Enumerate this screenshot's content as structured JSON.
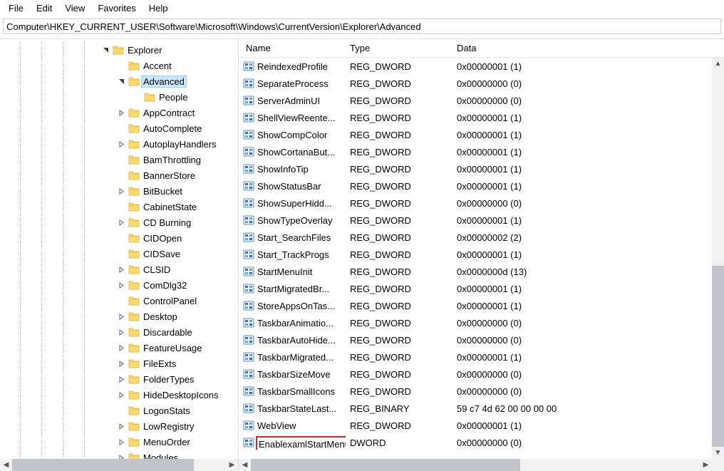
{
  "menu": {
    "items": [
      "File",
      "Edit",
      "View",
      "Favorites",
      "Help"
    ]
  },
  "address": "Computer\\HKEY_CURRENT_USER\\Software\\Microsoft\\Windows\\CurrentVersion\\Explorer\\Advanced",
  "columns": {
    "name": "Name",
    "type": "Type",
    "data": "Data"
  },
  "tree": [
    {
      "depth": 6,
      "label": "Explorer",
      "exp": "open"
    },
    {
      "depth": 7,
      "label": "Accent",
      "exp": "none"
    },
    {
      "depth": 7,
      "label": "Advanced",
      "exp": "open",
      "selected": true
    },
    {
      "depth": 8,
      "label": "People",
      "exp": "none"
    },
    {
      "depth": 7,
      "label": "AppContract",
      "exp": "closed"
    },
    {
      "depth": 7,
      "label": "AutoComplete",
      "exp": "none"
    },
    {
      "depth": 7,
      "label": "AutoplayHandlers",
      "exp": "closed"
    },
    {
      "depth": 7,
      "label": "BamThrottling",
      "exp": "none"
    },
    {
      "depth": 7,
      "label": "BannerStore",
      "exp": "none"
    },
    {
      "depth": 7,
      "label": "BitBucket",
      "exp": "closed"
    },
    {
      "depth": 7,
      "label": "CabinetState",
      "exp": "none"
    },
    {
      "depth": 7,
      "label": "CD Burning",
      "exp": "closed"
    },
    {
      "depth": 7,
      "label": "CIDOpen",
      "exp": "none"
    },
    {
      "depth": 7,
      "label": "CIDSave",
      "exp": "none"
    },
    {
      "depth": 7,
      "label": "CLSID",
      "exp": "closed"
    },
    {
      "depth": 7,
      "label": "ComDlg32",
      "exp": "closed"
    },
    {
      "depth": 7,
      "label": "ControlPanel",
      "exp": "none"
    },
    {
      "depth": 7,
      "label": "Desktop",
      "exp": "closed"
    },
    {
      "depth": 7,
      "label": "Discardable",
      "exp": "closed"
    },
    {
      "depth": 7,
      "label": "FeatureUsage",
      "exp": "closed"
    },
    {
      "depth": 7,
      "label": "FileExts",
      "exp": "closed"
    },
    {
      "depth": 7,
      "label": "FolderTypes",
      "exp": "closed"
    },
    {
      "depth": 7,
      "label": "HideDesktopIcons",
      "exp": "closed"
    },
    {
      "depth": 7,
      "label": "LogonStats",
      "exp": "none"
    },
    {
      "depth": 7,
      "label": "LowRegistry",
      "exp": "closed"
    },
    {
      "depth": 7,
      "label": "MenuOrder",
      "exp": "closed"
    },
    {
      "depth": 7,
      "label": "Modules",
      "exp": "closed"
    }
  ],
  "values": [
    {
      "name": "ReindexedProfile",
      "type": "REG_DWORD",
      "data": "0x00000001 (1)"
    },
    {
      "name": "SeparateProcess",
      "type": "REG_DWORD",
      "data": "0x00000000 (0)"
    },
    {
      "name": "ServerAdminUI",
      "type": "REG_DWORD",
      "data": "0x00000000 (0)"
    },
    {
      "name": "ShellViewReente...",
      "type": "REG_DWORD",
      "data": "0x00000001 (1)"
    },
    {
      "name": "ShowCompColor",
      "type": "REG_DWORD",
      "data": "0x00000001 (1)"
    },
    {
      "name": "ShowCortanaBut...",
      "type": "REG_DWORD",
      "data": "0x00000001 (1)"
    },
    {
      "name": "ShowInfoTip",
      "type": "REG_DWORD",
      "data": "0x00000001 (1)"
    },
    {
      "name": "ShowStatusBar",
      "type": "REG_DWORD",
      "data": "0x00000001 (1)"
    },
    {
      "name": "ShowSuperHidd...",
      "type": "REG_DWORD",
      "data": "0x00000000 (0)"
    },
    {
      "name": "ShowTypeOverlay",
      "type": "REG_DWORD",
      "data": "0x00000001 (1)"
    },
    {
      "name": "Start_SearchFiles",
      "type": "REG_DWORD",
      "data": "0x00000002 (2)"
    },
    {
      "name": "Start_TrackProgs",
      "type": "REG_DWORD",
      "data": "0x00000001 (1)"
    },
    {
      "name": "StartMenuInit",
      "type": "REG_DWORD",
      "data": "0x0000000d (13)"
    },
    {
      "name": "StartMigratedBr...",
      "type": "REG_DWORD",
      "data": "0x00000001 (1)"
    },
    {
      "name": "StoreAppsOnTas...",
      "type": "REG_DWORD",
      "data": "0x00000001 (1)"
    },
    {
      "name": "TaskbarAnimatio...",
      "type": "REG_DWORD",
      "data": "0x00000000 (0)"
    },
    {
      "name": "TaskbarAutoHide...",
      "type": "REG_DWORD",
      "data": "0x00000000 (0)"
    },
    {
      "name": "TaskbarMigrated...",
      "type": "REG_DWORD",
      "data": "0x00000001 (1)"
    },
    {
      "name": "TaskbarSizeMove",
      "type": "REG_DWORD",
      "data": "0x00000000 (0)"
    },
    {
      "name": "TaskbarSmallIcons",
      "type": "REG_DWORD",
      "data": "0x00000000 (0)"
    },
    {
      "name": "TaskbarStateLast...",
      "type": "REG_BINARY",
      "data": "59 c7 4d 62 00 00 00 00"
    },
    {
      "name": "WebView",
      "type": "REG_DWORD",
      "data": "0x00000001 (1)"
    },
    {
      "name": "EnablexamlStartMenu",
      "type": "DWORD",
      "data": "0x00000000 (0)",
      "editing": true
    }
  ],
  "rename_value": "EnablexamlStartMenu"
}
